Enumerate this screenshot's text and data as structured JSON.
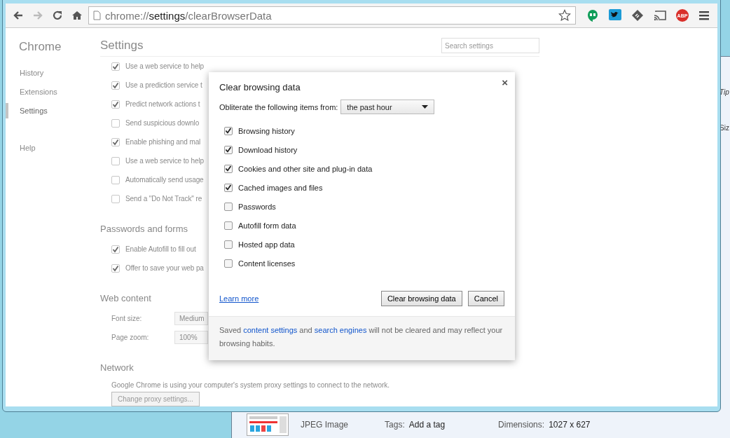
{
  "browser": {
    "nav": [
      {
        "kind": "back",
        "disabled": false
      },
      {
        "kind": "forward",
        "disabled": true
      },
      {
        "kind": "reload",
        "disabled": false
      },
      {
        "kind": "home",
        "disabled": false
      }
    ],
    "address": {
      "scheme": "chrome://",
      "host": "settings",
      "path": "/clearBrowserData"
    },
    "extensions": [
      {
        "kind": "hangouts"
      },
      {
        "kind": "twitter"
      },
      {
        "kind": "feedly"
      },
      {
        "kind": "cast"
      },
      {
        "kind": "abp",
        "text": "ABP"
      }
    ]
  },
  "settings_page": {
    "brand": "Chrome",
    "nav": [
      {
        "label": "History",
        "selected": false
      },
      {
        "label": "Extensions",
        "selected": false
      },
      {
        "label": "Settings",
        "selected": true
      },
      {
        "label": "Help",
        "selected": false
      }
    ],
    "title": "Settings",
    "search": {
      "placeholder": "Search settings"
    },
    "sections": [
      {
        "items": [
          {
            "kind": "checkbox",
            "label": "Use a web service to help",
            "checked": true
          },
          {
            "kind": "checkbox",
            "label": "Use a prediction service t",
            "checked": true
          },
          {
            "kind": "checkbox",
            "label": "Predict network actions t",
            "checked": true
          },
          {
            "kind": "checkbox",
            "label": "Send suspicious downlo",
            "checked": false
          },
          {
            "kind": "checkbox",
            "label": "Enable phishing and mal",
            "checked": true
          },
          {
            "kind": "checkbox",
            "label": "Use a web service to help",
            "checked": false
          },
          {
            "kind": "checkbox",
            "label": "Automatically send usage",
            "checked": false
          },
          {
            "kind": "checkbox",
            "label": "Send a \"Do Not Track\" re",
            "checked": false
          }
        ]
      },
      {
        "heading": "Passwords and forms",
        "items": [
          {
            "kind": "checkbox",
            "label": "Enable Autofill to fill out",
            "checked": true
          },
          {
            "kind": "checkbox",
            "label": "Offer to save your web pa",
            "checked": true
          }
        ]
      },
      {
        "heading": "Web content",
        "items": [
          {
            "kind": "select",
            "label": "Font size:",
            "value": "Medium"
          },
          {
            "kind": "select",
            "label": "Page zoom:",
            "value": "100%"
          }
        ]
      },
      {
        "heading": "Network",
        "items": [
          {
            "kind": "text",
            "label": "Google Chrome is using your computer's system proxy settings to connect to the network."
          },
          {
            "kind": "button",
            "label": "Change proxy settings..."
          }
        ]
      }
    ]
  },
  "dialog": {
    "title": "Clear browsing data",
    "close": "×",
    "range_label": "Obliterate the following items from:",
    "range_value": "the past hour",
    "options": [
      {
        "label": "Browsing history",
        "checked": true
      },
      {
        "label": "Download history",
        "checked": true
      },
      {
        "label": "Cookies and other site and plug-in data",
        "checked": true
      },
      {
        "label": "Cached images and files",
        "checked": true
      },
      {
        "label": "Passwords",
        "checked": false
      },
      {
        "label": "Autofill form data",
        "checked": false
      },
      {
        "label": "Hosted app data",
        "checked": false
      },
      {
        "label": "Content licenses",
        "checked": false
      }
    ],
    "learn_more": "Learn more",
    "buttons": [
      "Clear browsing data",
      "Cancel"
    ],
    "footer": [
      {
        "kind": "text",
        "text": "Saved "
      },
      {
        "kind": "link",
        "text": "content settings"
      },
      {
        "kind": "text",
        "text": " and "
      },
      {
        "kind": "link",
        "text": "search engines"
      },
      {
        "kind": "text",
        "text": " will not be cleared and may reflect your browsing habits."
      }
    ]
  },
  "explorer": {
    "side_labels": [
      "Tip",
      "Siz"
    ],
    "details": {
      "type": "JPEG Image",
      "tags_label": "Tags:",
      "tags_value": "Add a tag",
      "dimensions_label": "Dimensions:",
      "dimensions_value": "1027 x 627"
    }
  }
}
